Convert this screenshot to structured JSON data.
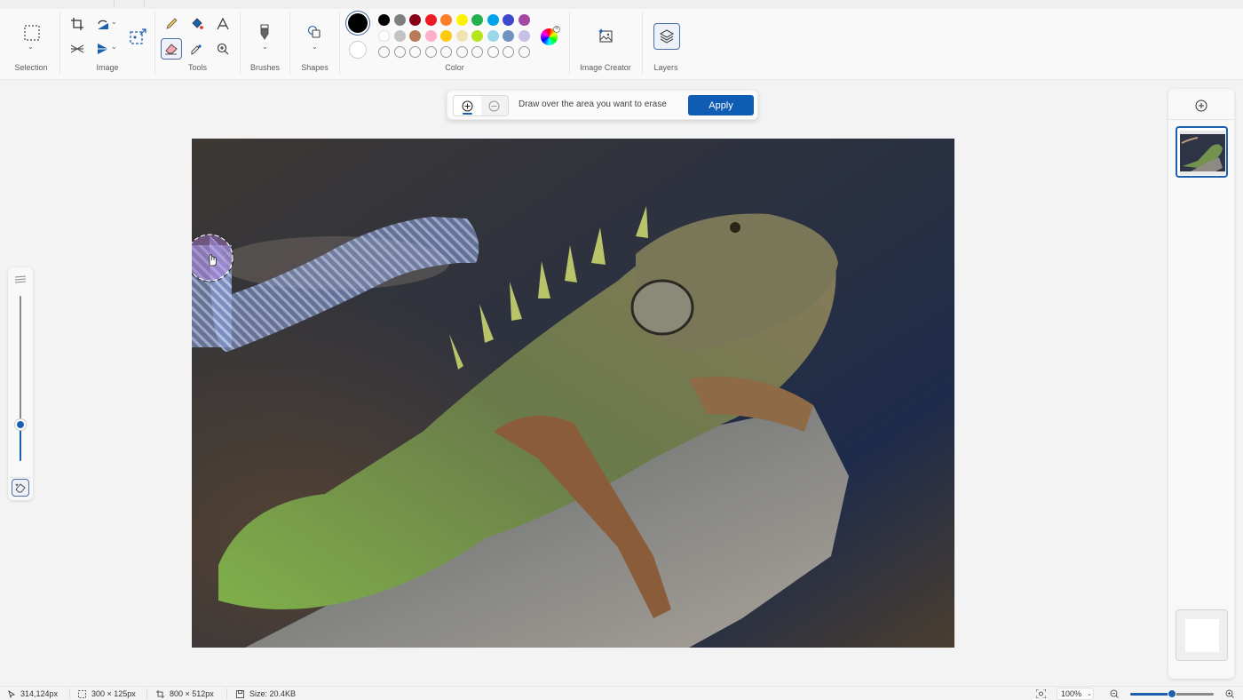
{
  "ribbon": {
    "groups": {
      "selection": "Selection",
      "image": "Image",
      "tools": "Tools",
      "brushes": "Brushes",
      "shapes": "Shapes",
      "color": "Color",
      "image_creator": "Image Creator",
      "layers": "Layers"
    },
    "colors": {
      "primary": "#000000",
      "secondary": "#ffffff",
      "row1": [
        "#000000",
        "#7f7f7f",
        "#880015",
        "#ed1c24",
        "#ff7f27",
        "#fff200",
        "#22b14c",
        "#00a2e8",
        "#3f48cc",
        "#a349a4"
      ],
      "row2": [
        "#ffffff",
        "#c3c3c3",
        "#b97a57",
        "#ffaec9",
        "#ffc90e",
        "#efe4b0",
        "#b5e61d",
        "#99d9ea",
        "#7092be",
        "#c8bfe7"
      ],
      "custom_slots": 10
    },
    "active_tool": "eraser"
  },
  "erase_bar": {
    "hint": "Draw over the area you want to erase",
    "apply_label": "Apply",
    "mode": "add"
  },
  "brush_size": {
    "value_fraction": 0.22
  },
  "layers_panel": {
    "layer_count": 2,
    "selected_layer": 1
  },
  "status": {
    "cursor_pos": "314,124px",
    "selection_size": "300 × 125px",
    "canvas_size": "800 × 512px",
    "file_size": "Size: 20.4KB",
    "zoom_label": "100%",
    "zoom_fraction": 0.5
  },
  "accent": "#0f5cb5"
}
